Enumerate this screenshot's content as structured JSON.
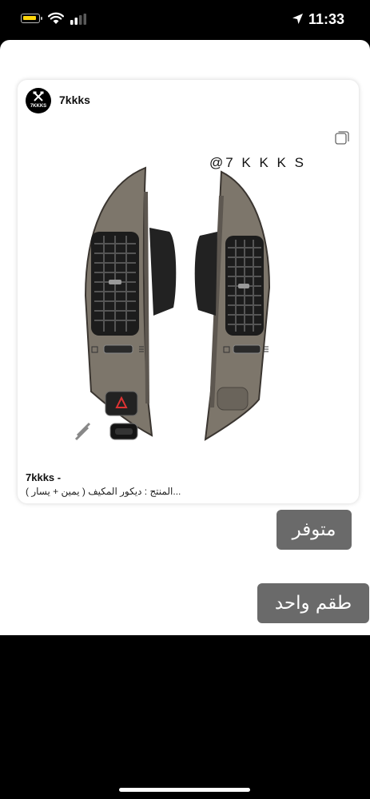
{
  "status_bar": {
    "time": "11:33",
    "battery_level": 0.35,
    "battery_color": "#ffd60a"
  },
  "post": {
    "avatar_text": "7KKKS",
    "username": "7kkks",
    "watermark": "@7 K K K S",
    "caption_user": "7kkks -",
    "caption_text": "المنتج : ديكور المكيف ( يمين + يسار )..."
  },
  "messages": [
    {
      "text": "متوفر"
    },
    {
      "text": "طقم واحد"
    }
  ],
  "colors": {
    "bubble": "#6a6a6a",
    "background": "#000000",
    "sheet": "#ffffff"
  }
}
